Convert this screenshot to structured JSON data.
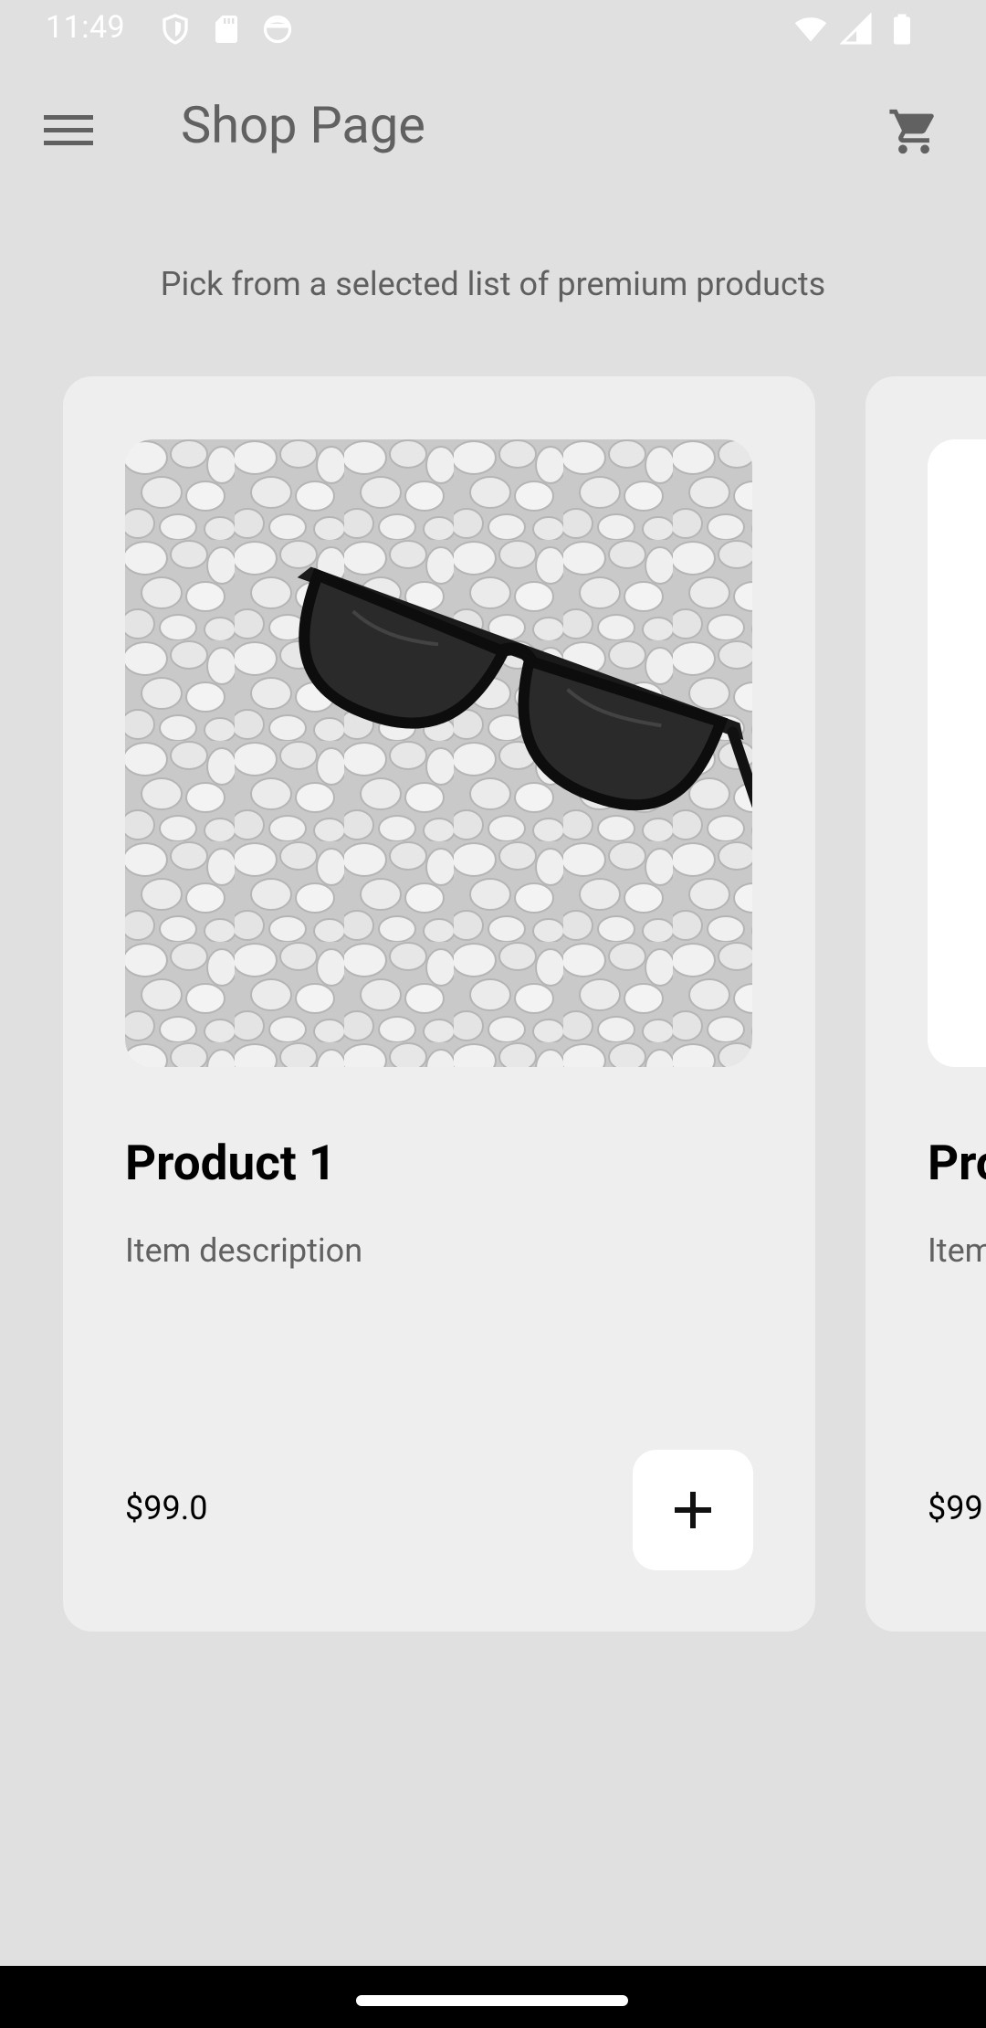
{
  "status_bar": {
    "time": "11:49",
    "left_icons": [
      "shield-icon",
      "sd-card-icon",
      "face-icon"
    ],
    "right_icons": [
      "wifi-icon",
      "signal-icon",
      "battery-icon"
    ]
  },
  "app_bar": {
    "title": "Shop Page",
    "menu_icon": "hamburger-menu-icon",
    "cart_icon": "shopping-cart-icon"
  },
  "subtitle": "Pick from a selected list of premium products",
  "products": [
    {
      "title": "Product 1",
      "description": "Item description",
      "price": "$99.0",
      "image": "sunglasses-on-pebbles",
      "add_icon": "plus-icon"
    },
    {
      "title": "Pro",
      "description": "Item",
      "price": "$99",
      "image": "blank"
    }
  ],
  "colors": {
    "background": "#e0e0e0",
    "card": "#eeeeee",
    "title_text": "#616161",
    "nav_bar": "#000000"
  }
}
